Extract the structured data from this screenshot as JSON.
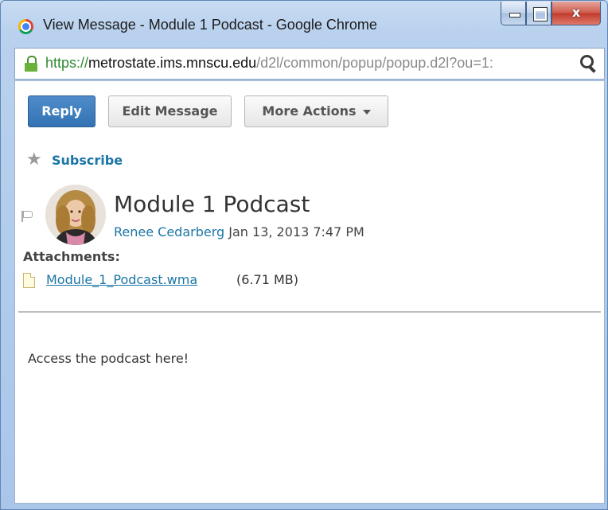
{
  "window": {
    "title": "View Message - Module 1 Podcast - Google Chrome",
    "close_glyph": "x"
  },
  "address_bar": {
    "scheme": "https://",
    "host": "metrostate.ims.mnscu.edu",
    "path": "/d2l/common/popup/popup.d2l?ou=1:"
  },
  "toolbar": {
    "reply_label": "Reply",
    "edit_label": "Edit Message",
    "more_label": "More Actions"
  },
  "subscribe": {
    "label": "Subscribe",
    "icon": "star-icon"
  },
  "message": {
    "title": "Module 1 Podcast",
    "author": "Renee Cedarberg",
    "date": "Jan 13, 2013 7:47 PM",
    "attachments_label": "Attachments:",
    "attachment": {
      "name": "Module_1_Podcast.wma",
      "size": "(6.71 MB)"
    },
    "body": "Access the podcast here!"
  },
  "colors": {
    "link": "#1b75a6",
    "primary_button": "#3373b3",
    "secure_scheme": "#2e8b32"
  }
}
